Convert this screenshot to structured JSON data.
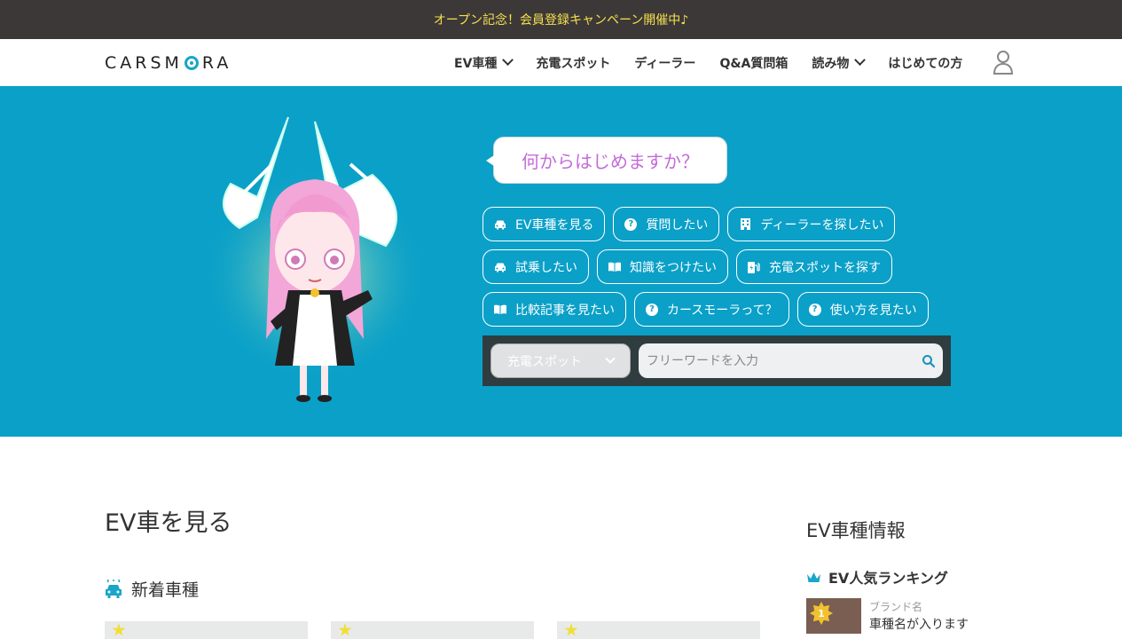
{
  "announcement": "オープン記念！会員登録キャンペーン開催中♪",
  "header": {
    "logo_pre": "CARSM",
    "logo_post": "RA",
    "nav": [
      {
        "label": "EV車種",
        "dropdown": true
      },
      {
        "label": "充電スポット",
        "dropdown": false
      },
      {
        "label": "ディーラー",
        "dropdown": false
      },
      {
        "label": "Q&A質問箱",
        "dropdown": false
      },
      {
        "label": "読み物",
        "dropdown": true
      },
      {
        "label": "はじめての方",
        "dropdown": false
      }
    ],
    "user_icon": "user-icon"
  },
  "hero": {
    "bubble": "何からはじめますか？",
    "chips": [
      {
        "label": "EV車種を見る",
        "icon": "car-icon"
      },
      {
        "label": "質問したい",
        "icon": "question-icon"
      },
      {
        "label": "ディーラーを探したい",
        "icon": "building-icon"
      },
      {
        "label": "試乗したい",
        "icon": "car-icon"
      },
      {
        "label": "知識をつけたい",
        "icon": "book-icon"
      },
      {
        "label": "充電スポットを探す",
        "icon": "charging-icon"
      },
      {
        "label": "比較記事を見たい",
        "icon": "book-icon"
      },
      {
        "label": "カースモーラって？",
        "icon": "question-icon"
      },
      {
        "label": "使い方を見たい",
        "icon": "question-icon"
      }
    ],
    "search": {
      "category": "充電スポット",
      "placeholder": "フリーワードを入力"
    }
  },
  "main": {
    "title": "EV車を見る",
    "section_title": "新着車種"
  },
  "sidebar": {
    "title": "EV車種情報",
    "ranking_title": "EV人気ランキング",
    "ranking": [
      {
        "rank": "1",
        "brand": "ブランド名",
        "name": "車種名が入ります"
      }
    ]
  },
  "colors": {
    "hero_bg": "#0aa0c8",
    "announce_bg": "#3d3838",
    "announce_text": "#f4e04d",
    "bubble_text": "#c56bd8",
    "accent": "#1aa5c9"
  }
}
